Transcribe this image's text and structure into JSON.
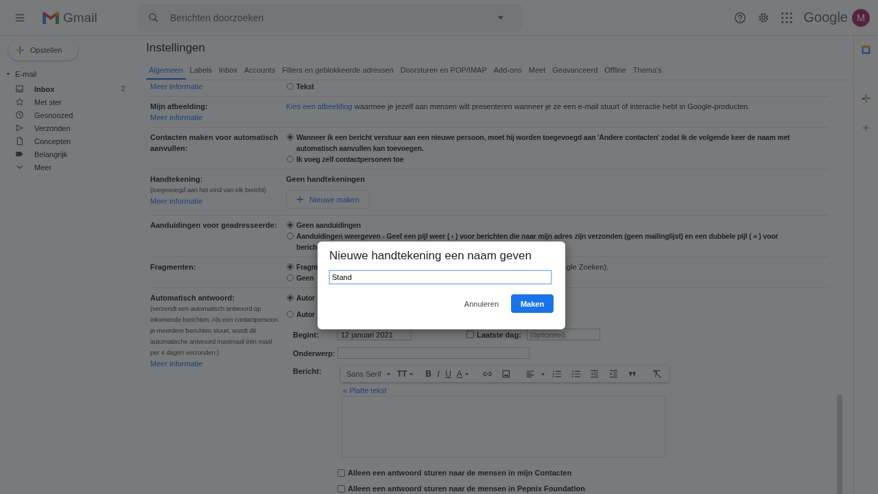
{
  "header": {
    "app_name": "Gmail",
    "search_placeholder": "Berichten doorzoeken",
    "brand": "Google",
    "avatar_letter": "M"
  },
  "sidebar": {
    "compose": "Opstellen",
    "section": "E-mail",
    "section_expanded": true,
    "items": [
      {
        "label": "Inbox",
        "kind": "inbox",
        "count": "2",
        "unread": true
      },
      {
        "label": "Met ster",
        "kind": "star",
        "unread": false
      },
      {
        "label": "Gesnoozed",
        "kind": "clock",
        "unread": false
      },
      {
        "label": "Verzonden",
        "kind": "send",
        "unread": false
      },
      {
        "label": "Concepten",
        "kind": "file",
        "unread": false
      },
      {
        "label": "Belangrijk",
        "kind": "label",
        "unread": false
      },
      {
        "label": "Meer",
        "kind": "chevron",
        "unread": false
      }
    ]
  },
  "settings": {
    "title": "Instellingen",
    "tabs": [
      {
        "label": "Algemeen",
        "selected": true
      },
      {
        "label": "Labels",
        "selected": false
      },
      {
        "label": "Inbox",
        "selected": false
      },
      {
        "label": "Accounts",
        "selected": false
      },
      {
        "label": "Filters en geblokkeerde adressen",
        "selected": false
      },
      {
        "label": "Doorsturen en POP/IMAP",
        "selected": false
      },
      {
        "label": "Add-ons",
        "selected": false
      },
      {
        "label": "Meet",
        "selected": false
      },
      {
        "label": "Geavanceerd",
        "selected": false
      },
      {
        "label": "Offline",
        "selected": false
      },
      {
        "label": "Thema's",
        "selected": false
      }
    ],
    "rows": [
      {
        "link": "Meer informatie",
        "content": [
          {
            "kind": "radio",
            "selected": false,
            "lines": [
              "Tekst"
            ]
          }
        ]
      },
      {
        "label": "Mijn afbeelding:",
        "link": "Meer informatie",
        "content": [
          {
            "kind": "link_text",
            "link": "Kies een afbeelding",
            "text": "waarmee je jezelf aan mensen wilt presenteren wanneer je ze een e-mail stuurt of interactie hebt in Google-producten."
          }
        ]
      },
      {
        "label": "Contacten maken voor automatisch aanvullen:",
        "content": [
          {
            "kind": "radio",
            "selected": true,
            "lines": [
              "Wanneer ik een bericht verstuur aan een nieuwe persoon, moet hij worden toegevoegd aan 'Andere contacten' zodat ik de volgende keer de naam met",
              "automatisch aanvullen kan toevoegen."
            ]
          },
          {
            "kind": "radio",
            "selected": false,
            "lines": [
              "Ik voeg zelf contactpersonen toe"
            ]
          }
        ]
      },
      {
        "label": "Handtekening:",
        "note": "(toegevoegd aan het eind van elk bericht)",
        "link": "Meer informatie",
        "content": [
          {
            "kind": "heading",
            "text": "Geen handtekeningen"
          },
          {
            "kind": "button",
            "label": "Nieuwe maken"
          }
        ]
      },
      {
        "label": "Aanduidingen voor geadresseerde:",
        "content": [
          {
            "kind": "radio",
            "selected": true,
            "lines": [
              "Geen aanduidingen"
            ]
          },
          {
            "kind": "radio",
            "selected": false,
            "lines": [
              "**Aanduidingen weergeven** - Geef een pijl weer ( › ) voor berichten die naar mijn adres zijn verzonden (geen mailinglijst) en een dubbele pijl ( » ) voor",
              "berich"
            ]
          }
        ]
      },
      {
        "label": "Fragmenten:",
        "content": [
          {
            "kind": "radio",
            "selected": true,
            "lines": [
              "Fragm"
            ],
            "tail": "gle Zoeken)."
          },
          {
            "kind": "radio",
            "selected": false,
            "lines": [
              "Geen"
            ]
          }
        ]
      },
      {
        "label": "Automatisch antwoord:",
        "note": "(verzendt een automatisch antwoord op inkomende berichten. Als een contactpersoon je meerdere berichten stuurt, wordt dit automatische antwoord maximaal één maal per 4 dagen verzonden.)",
        "link": "Meer informatie",
        "content": [
          {
            "kind": "radio",
            "selected": true,
            "lines": [
              "Autor"
            ]
          },
          {
            "kind": "radio",
            "selected": false,
            "lines": [
              "Autor"
            ]
          },
          {
            "kind": "dates",
            "start_label": "Begint:",
            "start_value": "12 januari 2021",
            "end_checked": false,
            "end_label": "Laatste dag:",
            "end_placeholder": "(optioneel)"
          },
          {
            "kind": "subject",
            "label": "Onderwerp:"
          },
          {
            "kind": "message",
            "label": "Bericht:",
            "plain_link": "« Platte tekst",
            "toolbar": [
              {
                "kind": "font",
                "label": "Sans Serif"
              },
              {
                "kind": "size",
                "label": "TT"
              },
              {
                "kind": "bold",
                "label": "B"
              },
              {
                "kind": "italic",
                "label": "I"
              },
              {
                "kind": "underline",
                "label": "U"
              },
              {
                "kind": "color",
                "label": "A"
              },
              {
                "kind": "link"
              },
              {
                "kind": "image"
              },
              {
                "kind": "align"
              },
              {
                "kind": "numbered"
              },
              {
                "kind": "bulleted"
              },
              {
                "kind": "outdent"
              },
              {
                "kind": "indent"
              },
              {
                "kind": "quote"
              },
              {
                "kind": "clear"
              }
            ]
          },
          {
            "kind": "checkbox",
            "checked": false,
            "text": "Alleen een antwoord sturen naar de mensen in mijn Contacten"
          },
          {
            "kind": "checkbox",
            "checked": false,
            "text": "Alleen een antwoord sturen naar de mensen in Pepnix Foundation"
          }
        ]
      }
    ]
  },
  "dialog": {
    "title": "Nieuwe handtekening een naam geven",
    "value": "Stand",
    "cancel": "Annuleren",
    "confirm": "Maken"
  }
}
